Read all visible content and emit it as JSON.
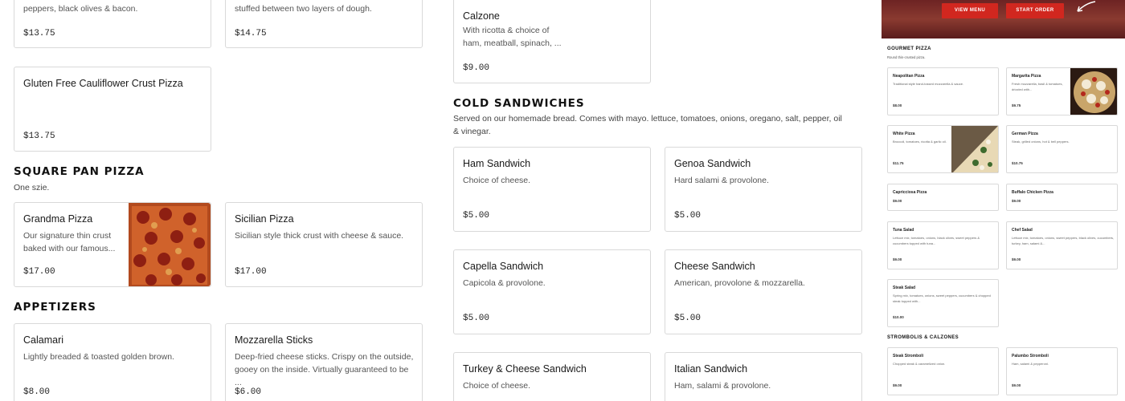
{
  "left_column": {
    "top_cards": [
      {
        "desc": "peppers, black olives & bacon.",
        "price": "$13.75"
      },
      {
        "desc": "stuffed between two layers of dough.",
        "price": "$14.75"
      }
    ],
    "gluten_free": {
      "name": "Gluten Free Cauliflower Crust Pizza",
      "price": "$13.75"
    },
    "square_pan": {
      "title": "SQUARE PAN PIZZA",
      "desc": "One szie.",
      "items": [
        {
          "name": "Grandma Pizza",
          "desc": "Our signature thin crust baked with our famous...",
          "price": "$17.00"
        },
        {
          "name": "Sicilian Pizza",
          "desc": "Sicilian style thick crust with cheese & sauce.",
          "price": "$17.00"
        }
      ]
    },
    "appetizers": {
      "title": "APPETIZERS",
      "items": [
        {
          "name": "Calamari",
          "desc": "Lightly breaded & toasted golden brown.",
          "price": "$8.00"
        },
        {
          "name": "Mozzarella Sticks",
          "desc": "Deep-fried cheese sticks. Crispy on the outside, gooey on the inside. Virtually guaranteed to be ...",
          "price": "$6.00"
        }
      ]
    }
  },
  "middle_column": {
    "calzone": {
      "name": "Calzone",
      "desc": "With ricotta & choice of ham, meatball, spinach, ...",
      "price": "$9.00"
    },
    "cold_sandwiches": {
      "title": "COLD SANDWICHES",
      "desc": "Served on our homemade bread. Comes with mayo. lettuce, tomatoes, onions, oregano, salt, pepper, oil & vinegar.",
      "items": [
        {
          "name": "Ham Sandwich",
          "desc": "Choice of cheese.",
          "price": "$5.00"
        },
        {
          "name": "Genoa Sandwich",
          "desc": "Hard salami & provolone.",
          "price": "$5.00"
        },
        {
          "name": "Capella Sandwich",
          "desc": "Capicola & provolone.",
          "price": "$5.00"
        },
        {
          "name": "Cheese Sandwich",
          "desc": "American, provolone & mozzarella.",
          "price": "$5.00"
        },
        {
          "name": "Turkey & Cheese Sandwich",
          "desc": "Choice of cheese."
        },
        {
          "name": "Italian Sandwich",
          "desc": "Ham, salami & provolone."
        }
      ]
    }
  },
  "preview": {
    "buttons": {
      "view_menu": "VIEW MENU",
      "start_order": "START ORDER"
    },
    "gourmet": {
      "title": "GOURMET PIZZA",
      "desc": "Round thin-crusted pizza."
    },
    "items": [
      {
        "name": "Neapolitan Pizza",
        "desc": "Traditional style hand-tossed mozzarella & sauce.",
        "price": "$8.00"
      },
      {
        "name": "Margarita Pizza",
        "desc": "Fresh mozzarella, basil & tomatoes, drizzled with...",
        "price": "$9.75"
      },
      {
        "name": "White Pizza",
        "desc": "Broccoli, tomatoes, ricotta & garlic oil.",
        "price": "$11.75"
      },
      {
        "name": "German Pizza",
        "desc": "Steak, grilled onions, hot & bell peppers.",
        "price": "$10.75"
      },
      {
        "name": "Capricciosa Pizza",
        "price": "$9.00"
      },
      {
        "name": "Buffalo Chicken Pizza",
        "price": "$9.00"
      },
      {
        "name": "Tuna Salad",
        "desc": "Lettuce mix, tomatoes, onions, black olives, sweet peppers & cucumbers topped with tuna...",
        "price": "$9.00"
      },
      {
        "name": "Chef Salad",
        "desc": "Lettuce mix, tomatoes, onions, sweet peppers, black olives, cucumbers, turkey, ham, salami &...",
        "price": "$9.00"
      },
      {
        "name": "Steak Salad",
        "desc": "Spring mix, tomatoes, onions, sweet peppers, cucumbers & chopped steak topped with...",
        "price": "$10.00"
      },
      {
        "name": "Steak Stromboli",
        "desc": "Chopped steak & caramelized onion.",
        "price": "$9.00"
      },
      {
        "name": "Palumbo Stromboli",
        "desc": "Ham, salami & pepperoni.",
        "price": "$9.00"
      }
    ],
    "strombolis_title": "STROMBOLIS & CALZONES"
  }
}
